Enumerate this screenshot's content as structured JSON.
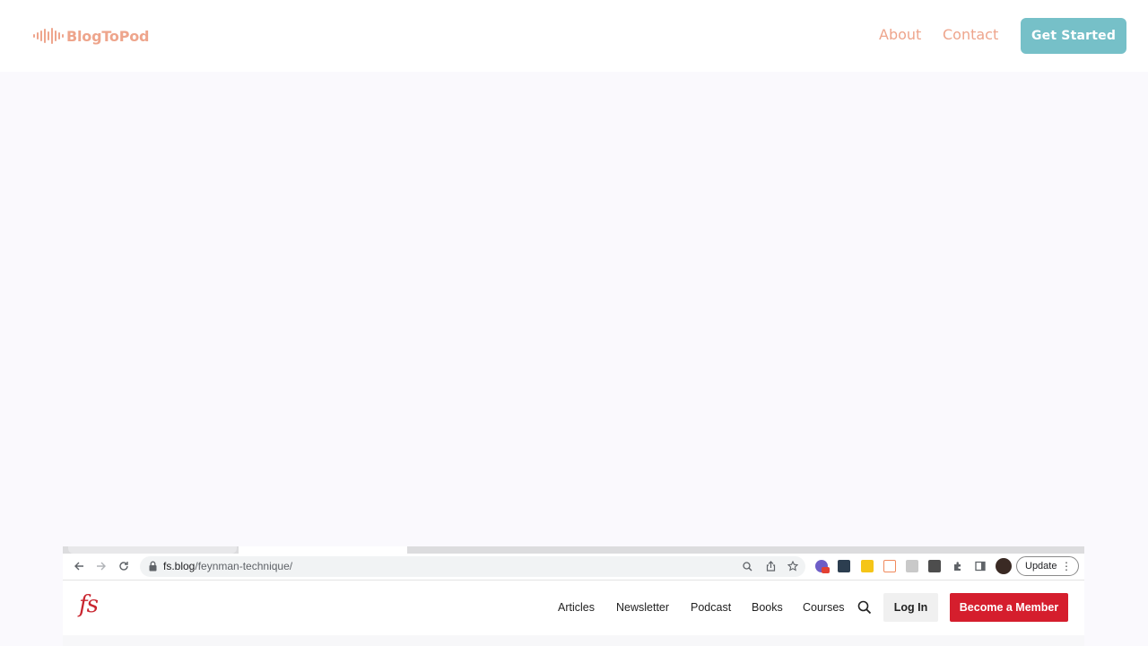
{
  "header": {
    "brand": "BlogToPod",
    "brand_color": "#eea58c",
    "logo_icon": "sound-wave-icon",
    "nav": [
      {
        "label": "About"
      },
      {
        "label": "Contact"
      }
    ],
    "cta_label": "Get Started",
    "cta_color": "#76c0c8"
  },
  "browser": {
    "url_domain": "fs.blog",
    "url_path": "/feynman-technique/",
    "update_label": "Update",
    "toolbar_icons": [
      "back-icon",
      "forward-icon",
      "reload-icon",
      "lock-icon",
      "zoom-icon",
      "share-icon",
      "star-icon",
      "puzzle-icon",
      "sidebar-icon",
      "menu-dots-icon"
    ],
    "page": {
      "logo_text": "fs",
      "logo_color": "#c9252f",
      "nav": [
        {
          "label": "Articles"
        },
        {
          "label": "Newsletter"
        },
        {
          "label": "Podcast"
        },
        {
          "label": "Books"
        },
        {
          "label": "Courses"
        }
      ],
      "login_label": "Log In",
      "member_label": "Become a Member",
      "member_color": "#d51e2d"
    }
  }
}
